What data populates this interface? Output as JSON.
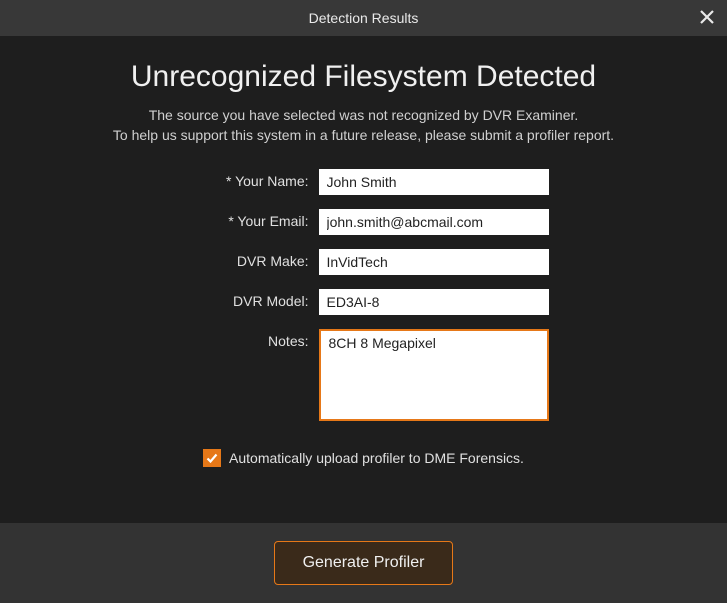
{
  "window": {
    "title": "Detection Results"
  },
  "heading": "Unrecognized Filesystem Detected",
  "subtext_line1": "The source you have selected was not recognized by DVR Examiner.",
  "subtext_line2": "To help us support this system in a future release, please submit a profiler report.",
  "form": {
    "name": {
      "label": "* Your Name:",
      "value": "John Smith"
    },
    "email": {
      "label": "* Your Email:",
      "value": "john.smith@abcmail.com"
    },
    "make": {
      "label": "DVR Make:",
      "value": "InVidTech"
    },
    "model": {
      "label": "DVR Model:",
      "value": "ED3AI-8"
    },
    "notes": {
      "label": "Notes:",
      "value": "8CH 8 Megapixel"
    }
  },
  "checkbox": {
    "checked": true,
    "label": "Automatically upload profiler to DME Forensics."
  },
  "button": {
    "generate": "Generate Profiler"
  }
}
